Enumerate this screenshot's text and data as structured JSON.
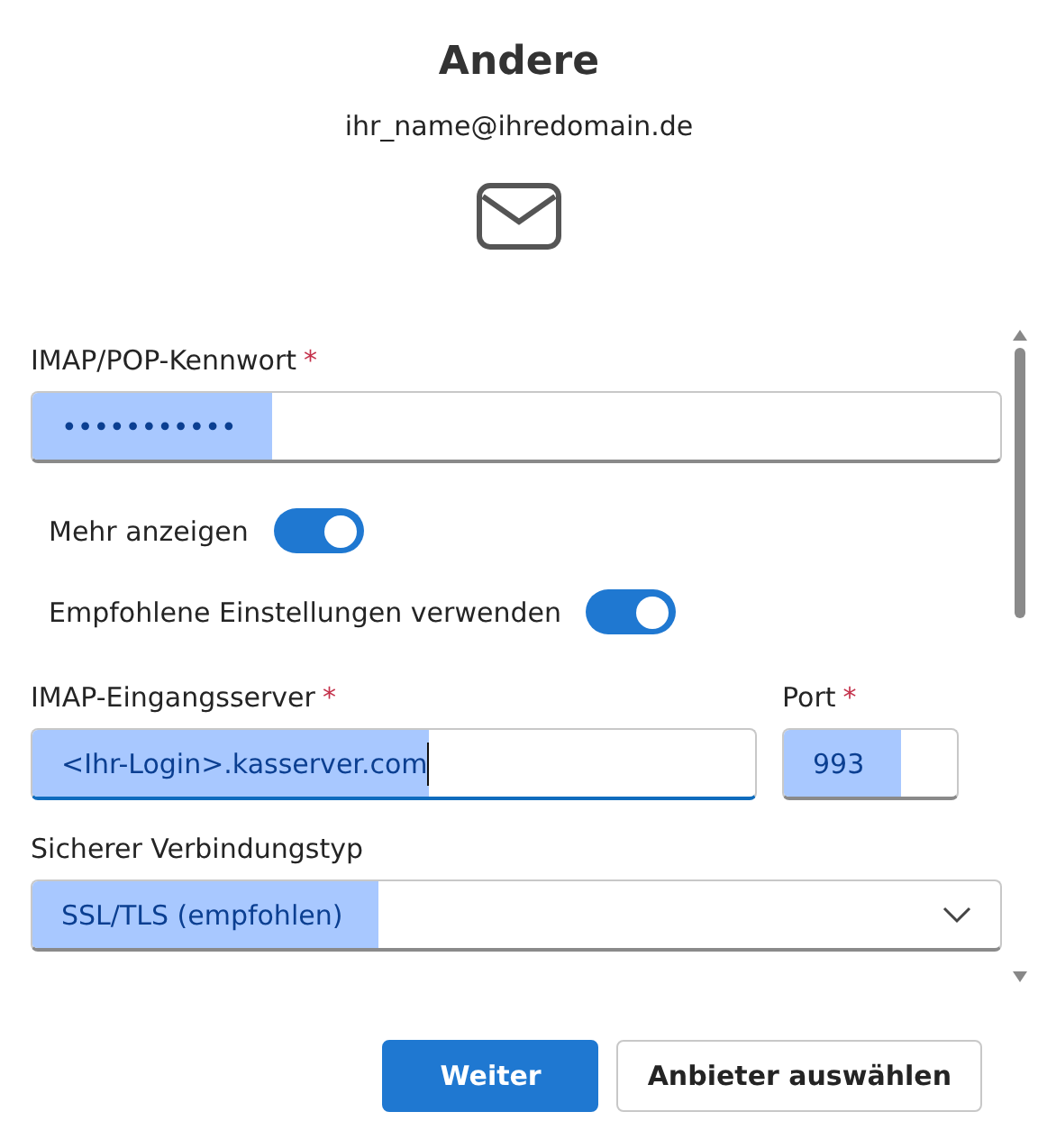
{
  "title": "Andere",
  "email": "ihr_name@ihredomain.de",
  "password": {
    "label": "IMAP/POP-Kennwort",
    "required_mark": "*",
    "value": "•••••••••••",
    "selected": true
  },
  "toggles": [
    {
      "label": "Mehr anzeigen",
      "on": true
    },
    {
      "label": "Empfohlene Einstellungen verwenden",
      "on": true
    }
  ],
  "server": {
    "label": "IMAP-Eingangsserver",
    "required_mark": "*",
    "value": "<Ihr-Login>.kasserver.com",
    "selected": true,
    "focused": true
  },
  "port": {
    "label": "Port",
    "required_mark": "*",
    "value": "993",
    "selected": true
  },
  "security": {
    "label": "Sicherer Verbindungstyp",
    "value": "SSL/TLS (empfohlen)",
    "selected": true
  },
  "buttons": [
    {
      "label": "Weiter",
      "kind": "primary"
    },
    {
      "label": "Anbieter auswählen",
      "kind": "secondary"
    }
  ]
}
